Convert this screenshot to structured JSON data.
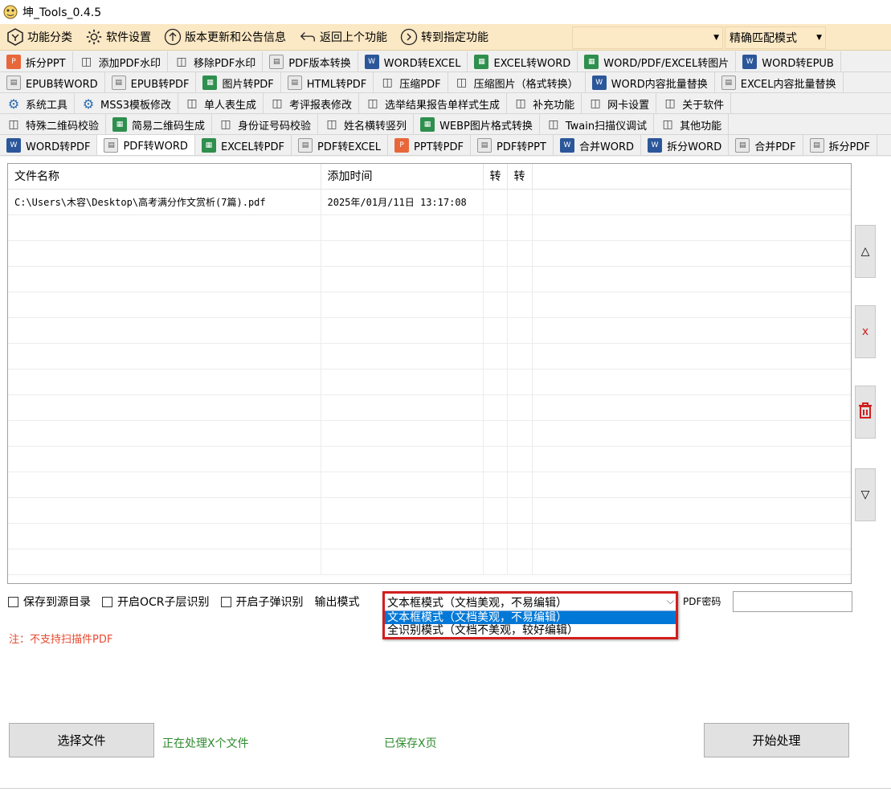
{
  "window": {
    "title": "坤_Tools_0.4.5"
  },
  "toolbar": {
    "buttons": [
      {
        "label": "功能分类",
        "icon": "category-icon"
      },
      {
        "label": "软件设置",
        "icon": "gear-icon"
      },
      {
        "label": "版本更新和公告信息",
        "icon": "arrow-up-circle-icon"
      },
      {
        "label": "返回上个功能",
        "icon": "return-icon"
      },
      {
        "label": "转到指定功能",
        "icon": "arrow-right-circle-icon"
      }
    ],
    "search_value": "",
    "match_mode": "精确匹配模式"
  },
  "tab_rows": [
    [
      {
        "label": "拆分PPT",
        "icon": "orange"
      },
      {
        "label": "添加PDF水印",
        "icon": "plain"
      },
      {
        "label": "移除PDF水印",
        "icon": "plain"
      },
      {
        "label": "PDF版本转换",
        "icon": "pdf"
      },
      {
        "label": "WORD转EXCEL",
        "icon": "word"
      },
      {
        "label": "EXCEL转WORD",
        "icon": "green"
      },
      {
        "label": "WORD/PDF/EXCEL转图片",
        "icon": "green"
      },
      {
        "label": "WORD转EPUB",
        "icon": "word"
      }
    ],
    [
      {
        "label": "EPUB转WORD",
        "icon": "pdf"
      },
      {
        "label": "EPUB转PDF",
        "icon": "pdf"
      },
      {
        "label": "图片转PDF",
        "icon": "green"
      },
      {
        "label": "HTML转PDF",
        "icon": "pdf"
      },
      {
        "label": "压缩PDF",
        "icon": "plain"
      },
      {
        "label": "压缩图片（格式转换）",
        "icon": "plain"
      },
      {
        "label": "WORD内容批量替换",
        "icon": "word"
      },
      {
        "label": "EXCEL内容批量替换",
        "icon": "pdf"
      }
    ],
    [
      {
        "label": "系统工具",
        "icon": "gear"
      },
      {
        "label": "MSS3模板修改",
        "icon": "gear"
      },
      {
        "label": "单人表生成",
        "icon": "plain"
      },
      {
        "label": "考评报表修改",
        "icon": "plain"
      },
      {
        "label": "选举结果报告单样式生成",
        "icon": "plain"
      },
      {
        "label": "补充功能",
        "icon": "plain"
      },
      {
        "label": "网卡设置",
        "icon": "plain"
      },
      {
        "label": "关于软件",
        "icon": "plain"
      }
    ],
    [
      {
        "label": "特殊二维码校验",
        "icon": "plain"
      },
      {
        "label": "简易二维码生成",
        "icon": "green"
      },
      {
        "label": "身份证号码校验",
        "icon": "plain"
      },
      {
        "label": "姓名横转竖列",
        "icon": "plain"
      },
      {
        "label": "WEBP图片格式转换",
        "icon": "green"
      },
      {
        "label": "Twain扫描仪调试",
        "icon": "plain"
      },
      {
        "label": "其他功能",
        "icon": "plain"
      }
    ],
    [
      {
        "label": "WORD转PDF",
        "icon": "word"
      },
      {
        "label": "PDF转WORD",
        "icon": "pdf",
        "active": true
      },
      {
        "label": "EXCEL转PDF",
        "icon": "green"
      },
      {
        "label": "PDF转EXCEL",
        "icon": "pdf"
      },
      {
        "label": "PPT转PDF",
        "icon": "orange"
      },
      {
        "label": "PDF转PPT",
        "icon": "pdf"
      },
      {
        "label": "合并WORD",
        "icon": "word"
      },
      {
        "label": "拆分WORD",
        "icon": "word"
      },
      {
        "label": "合并PDF",
        "icon": "pdf"
      },
      {
        "label": "拆分PDF",
        "icon": "pdf"
      }
    ]
  ],
  "file_table": {
    "columns": [
      "文件名称",
      "添加时间",
      "转",
      "转"
    ],
    "rows": [
      [
        "C:\\Users\\木容\\Desktop\\高考满分作文赏析(7篇).pdf",
        "2025年/01月/11日 13:17:08",
        "",
        ""
      ]
    ]
  },
  "side_buttons": {
    "up": "△",
    "delete": "x",
    "clear": "🗑",
    "down": "▽"
  },
  "options": {
    "save_to_source": "保存到源目录",
    "ocr_layer": "开启OCR子层识别",
    "popup_recognition": "开启子弹识别",
    "output_mode_label": "输出模式"
  },
  "output_mode": {
    "current": "文本框模式（文档美观，不易编辑）",
    "options": [
      "文本框模式（文档美观，不易编辑）",
      "全识别模式（文档不美观，较好编辑）"
    ]
  },
  "pdf_password": {
    "label": "PDF密码",
    "value": ""
  },
  "note": "注：不支持扫描件PDF",
  "actions": {
    "select_file": "选择文件",
    "start": "开始处理",
    "processing_status": "正在处理X个文件",
    "saved_status": "已保存X页"
  },
  "colors": {
    "toolbar_bg": "#fbe8c4",
    "highlight_border": "#d21e1e",
    "status_green": "#2e8b2e",
    "note_red": "#e8492f",
    "selection_blue": "#0078d7"
  }
}
